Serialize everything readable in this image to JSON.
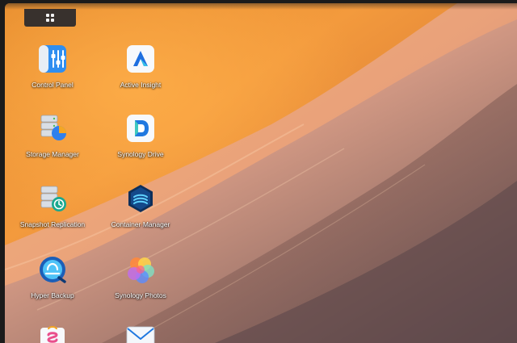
{
  "desktop": {
    "menu_button_icon": "grid-icon",
    "apps": [
      {
        "id": "control-panel",
        "label": "Control Panel",
        "icon": "control-panel-icon"
      },
      {
        "id": "active-insight",
        "label": "Active Insight",
        "icon": "active-insight-icon"
      },
      {
        "id": "storage-manager",
        "label": "Storage Manager",
        "icon": "storage-manager-icon"
      },
      {
        "id": "synology-drive",
        "label": "Synology Drive",
        "icon": "synology-drive-icon"
      },
      {
        "id": "snapshot-replication",
        "label": "Snapshot Replication",
        "icon": "snapshot-replication-icon"
      },
      {
        "id": "container-manager",
        "label": "Container Manager",
        "icon": "container-manager-icon"
      },
      {
        "id": "hyper-backup",
        "label": "Hyper Backup",
        "icon": "hyper-backup-icon"
      },
      {
        "id": "synology-photos",
        "label": "Synology Photos",
        "icon": "synology-photos-icon"
      },
      {
        "id": "package-center",
        "label": "",
        "icon": "package-center-icon"
      },
      {
        "id": "mail",
        "label": "",
        "icon": "mail-icon"
      }
    ]
  },
  "colors": {
    "accent": "#2f80ed",
    "taskbar": "#28282c",
    "label": "#ffffff"
  }
}
